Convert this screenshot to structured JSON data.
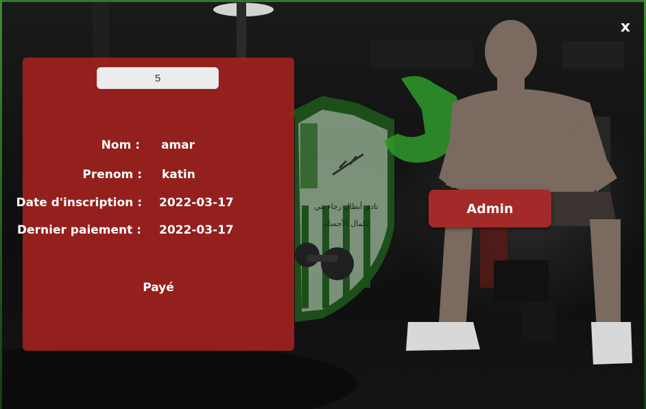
{
  "window": {
    "close_label": "x"
  },
  "member": {
    "id_value": "5",
    "fields": [
      {
        "label": "Nom :",
        "value": "amar"
      },
      {
        "label": "Prenom :",
        "value": "katin"
      },
      {
        "label": "Date d'inscription :",
        "value": "2022-03-17"
      },
      {
        "label": "Dernier paiement :",
        "value": "2022-03-17"
      }
    ],
    "status": "Payé"
  },
  "actions": {
    "admin_label": "Admin"
  },
  "background": {
    "description_icon": "gym-bodybuilder-photo",
    "logo_icon": "club-shield-logo"
  },
  "colors": {
    "panel": "#9e221e",
    "button": "#a32a28",
    "accent_green": "#2f7a2a"
  }
}
